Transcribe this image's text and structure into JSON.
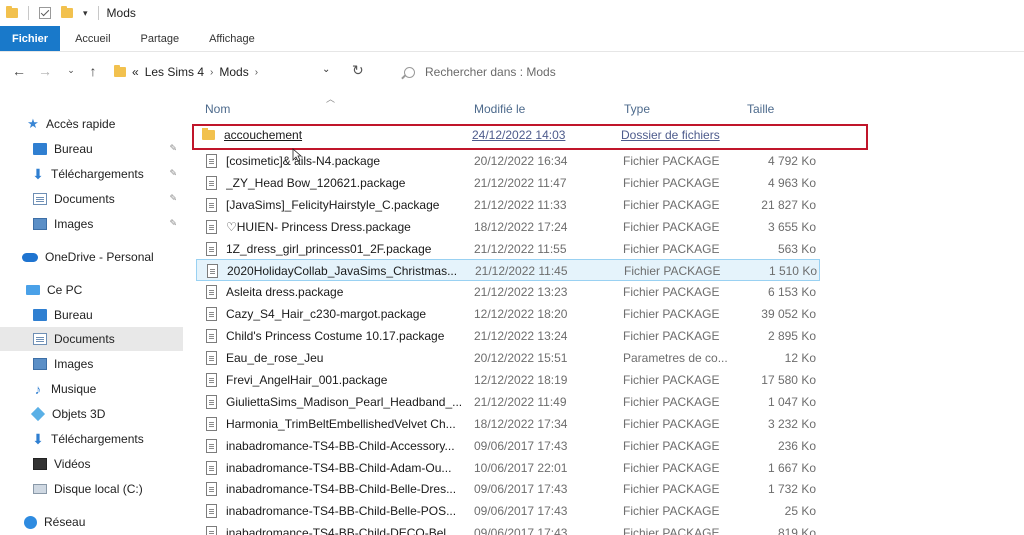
{
  "window": {
    "title": "Mods"
  },
  "ribbon": {
    "tabs": [
      "Fichier",
      "Accueil",
      "Partage",
      "Affichage"
    ]
  },
  "nav": {
    "breadcrumb": [
      "Les Sims 4",
      "Mods"
    ],
    "overflow": "«",
    "search_placeholder": "Rechercher dans : Mods"
  },
  "sidebar": {
    "items": [
      {
        "label": "Accès rapide",
        "icon": "star-icon"
      },
      {
        "label": "Bureau",
        "icon": "desktop-icon",
        "pinned": true
      },
      {
        "label": "Téléchargements",
        "icon": "download-icon",
        "pinned": true
      },
      {
        "label": "Documents",
        "icon": "document-icon",
        "pinned": true
      },
      {
        "label": "Images",
        "icon": "image-icon",
        "pinned": true
      },
      {
        "label": "OneDrive - Personal",
        "icon": "cloud-icon"
      },
      {
        "label": "Ce PC",
        "icon": "computer-icon"
      },
      {
        "label": "Bureau",
        "icon": "desktop-icon"
      },
      {
        "label": "Documents",
        "icon": "document-icon",
        "selected": true
      },
      {
        "label": "Images",
        "icon": "image-icon"
      },
      {
        "label": "Musique",
        "icon": "music-icon"
      },
      {
        "label": "Objets 3D",
        "icon": "cube-icon"
      },
      {
        "label": "Téléchargements",
        "icon": "download-icon"
      },
      {
        "label": "Vidéos",
        "icon": "video-icon"
      },
      {
        "label": "Disque local (C:)",
        "icon": "drive-icon"
      },
      {
        "label": "Réseau",
        "icon": "network-icon"
      }
    ]
  },
  "columns": {
    "name": "Nom",
    "modified": "Modifié le",
    "type": "Type",
    "size": "Taille"
  },
  "files": [
    {
      "name": "accouchement",
      "date": "24/12/2022 14:03",
      "type": "Dossier de fichiers",
      "size": "",
      "kind": "folder",
      "highlighted": true
    },
    {
      "name": "[cosimetic]& ails-N4.package",
      "date": "20/12/2022 16:34",
      "type": "Fichier PACKAGE",
      "size": "4 792 Ko",
      "kind": "file"
    },
    {
      "name": "_ZY_Head Bow_120621.package",
      "date": "21/12/2022 11:47",
      "type": "Fichier PACKAGE",
      "size": "4 963 Ko",
      "kind": "file"
    },
    {
      "name": "[JavaSims]_FelicityHairstyle_C.package",
      "date": "21/12/2022 11:33",
      "type": "Fichier PACKAGE",
      "size": "21 827 Ko",
      "kind": "file"
    },
    {
      "name": "♡HUIEN- Princess Dress.package",
      "date": "18/12/2022 17:24",
      "type": "Fichier PACKAGE",
      "size": "3 655 Ko",
      "kind": "file"
    },
    {
      "name": "1Z_dress_girl_princess01_2F.package",
      "date": "21/12/2022 11:55",
      "type": "Fichier PACKAGE",
      "size": "563 Ko",
      "kind": "file"
    },
    {
      "name": "2020HolidayCollab_JavaSims_Christmas...",
      "date": "21/12/2022 11:45",
      "type": "Fichier PACKAGE",
      "size": "1 510 Ko",
      "kind": "file",
      "selected": true
    },
    {
      "name": "Asleita dress.package",
      "date": "21/12/2022 13:23",
      "type": "Fichier PACKAGE",
      "size": "6 153 Ko",
      "kind": "file"
    },
    {
      "name": "Cazy_S4_Hair_c230-margot.package",
      "date": "12/12/2022 18:20",
      "type": "Fichier PACKAGE",
      "size": "39 052 Ko",
      "kind": "file"
    },
    {
      "name": "Child's Princess Costume 10.17.package",
      "date": "21/12/2022 13:24",
      "type": "Fichier PACKAGE",
      "size": "2 895 Ko",
      "kind": "file"
    },
    {
      "name": "Eau_de_rose_Jeu",
      "date": "20/12/2022 15:51",
      "type": "Parametres de co...",
      "size": "12 Ko",
      "kind": "file"
    },
    {
      "name": "Frevi_AngelHair_001.package",
      "date": "12/12/2022 18:19",
      "type": "Fichier PACKAGE",
      "size": "17 580 Ko",
      "kind": "file"
    },
    {
      "name": "GiuliettaSims_Madison_Pearl_Headband_...",
      "date": "21/12/2022 11:49",
      "type": "Fichier PACKAGE",
      "size": "1 047 Ko",
      "kind": "file"
    },
    {
      "name": "Harmonia_TrimBeltEmbellishedVelvet Ch...",
      "date": "18/12/2022 17:34",
      "type": "Fichier PACKAGE",
      "size": "3 232 Ko",
      "kind": "file"
    },
    {
      "name": "inabadromance-TS4-BB-Child-Accessory...",
      "date": "09/06/2017 17:43",
      "type": "Fichier PACKAGE",
      "size": "236 Ko",
      "kind": "file"
    },
    {
      "name": "inabadromance-TS4-BB-Child-Adam-Ou...",
      "date": "10/06/2017 22:01",
      "type": "Fichier PACKAGE",
      "size": "1 667 Ko",
      "kind": "file"
    },
    {
      "name": "inabadromance-TS4-BB-Child-Belle-Dres...",
      "date": "09/06/2017 17:43",
      "type": "Fichier PACKAGE",
      "size": "1 732 Ko",
      "kind": "file"
    },
    {
      "name": "inabadromance-TS4-BB-Child-Belle-POS...",
      "date": "09/06/2017 17:43",
      "type": "Fichier PACKAGE",
      "size": "25 Ko",
      "kind": "file"
    },
    {
      "name": "inabadromance-TS4-BB-Child-DECO-Bel...",
      "date": "09/06/2017 17:43",
      "type": "Fichier PACKAGE",
      "size": "819 Ko",
      "kind": "file"
    }
  ]
}
